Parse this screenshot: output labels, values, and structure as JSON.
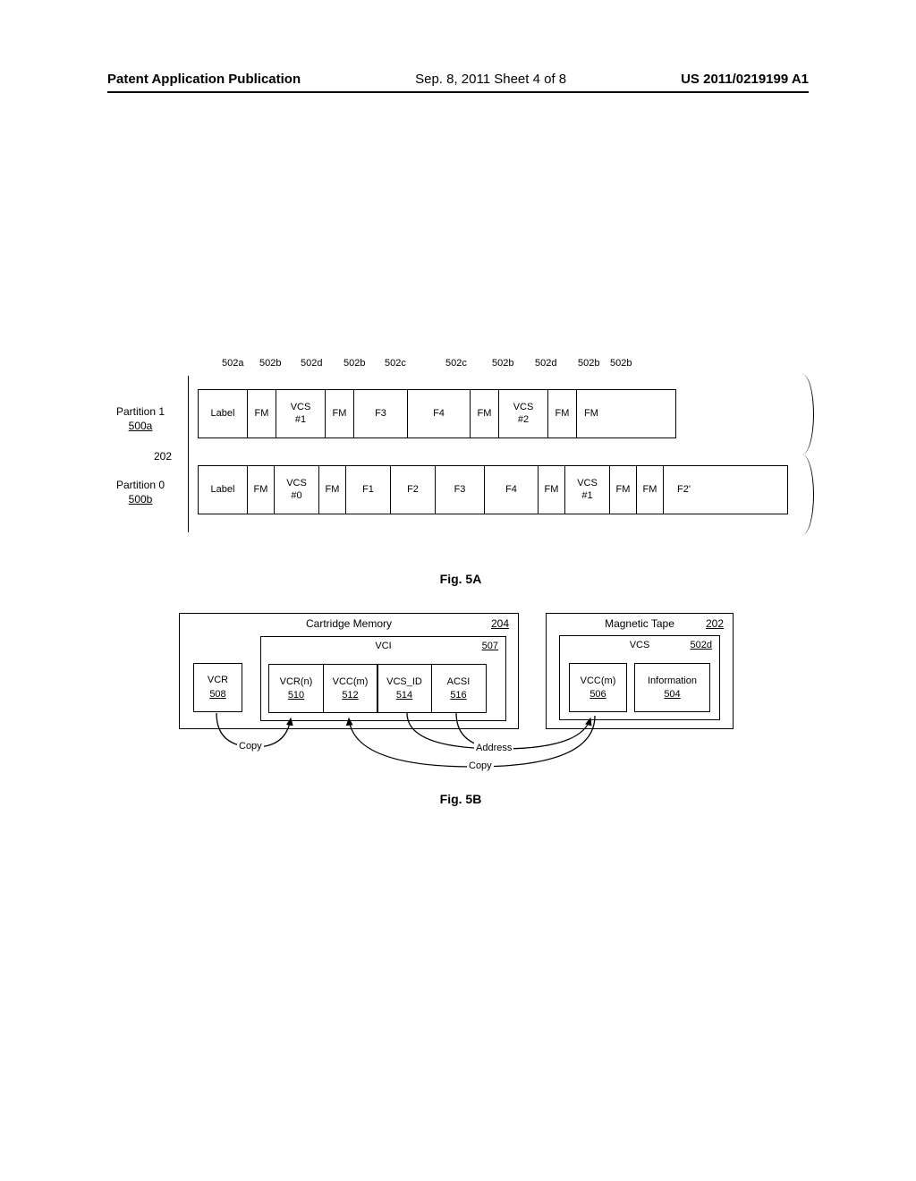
{
  "header": {
    "left": "Patent Application Publication",
    "mid": "Sep. 8, 2011  Sheet 4 of 8",
    "right": "US 2011/0219199 A1"
  },
  "fig5a": {
    "caption": "Fig. 5A",
    "p1": {
      "name": "Partition 1",
      "ref": "500a"
    },
    "p0": {
      "name": "Partition 0",
      "ref": "500b"
    },
    "ref202": "202",
    "row1": [
      "Label",
      "FM",
      "VCS\n#1",
      "FM",
      "F3",
      "F4",
      "FM",
      "VCS\n#2",
      "FM",
      "FM"
    ],
    "row0": [
      "Label",
      "FM",
      "VCS\n#0",
      "FM",
      "F1",
      "F2",
      "F3",
      "F4",
      "FM",
      "VCS\n#1",
      "FM",
      "FM",
      "F2'"
    ],
    "callouts": [
      "502a",
      "502b",
      "502d",
      "502b",
      "502c",
      "502c",
      "502b",
      "502d",
      "502b",
      "502b"
    ]
  },
  "fig5b": {
    "caption": "Fig. 5B",
    "cartmem": {
      "title": "Cartridge Memory",
      "ref": "204"
    },
    "magtape": {
      "title": "Magnetic Tape",
      "ref": "202"
    },
    "vcr": {
      "label": "VCR",
      "ref": "508"
    },
    "vci": {
      "title": "VCI",
      "ref": "507",
      "cells": [
        {
          "label": "VCR(n)",
          "ref": "510"
        },
        {
          "label": "VCC(m)",
          "ref": "512"
        },
        {
          "label": "VCS_ID",
          "ref": "514"
        },
        {
          "label": "ACSI",
          "ref": "516"
        }
      ]
    },
    "vcs": {
      "title": "VCS",
      "ref": "502d",
      "cells": [
        {
          "label": "VCC(m)",
          "ref": "506"
        },
        {
          "label": "Information",
          "ref": "504"
        }
      ]
    },
    "conn": {
      "copy": "Copy",
      "address": "Address"
    }
  }
}
